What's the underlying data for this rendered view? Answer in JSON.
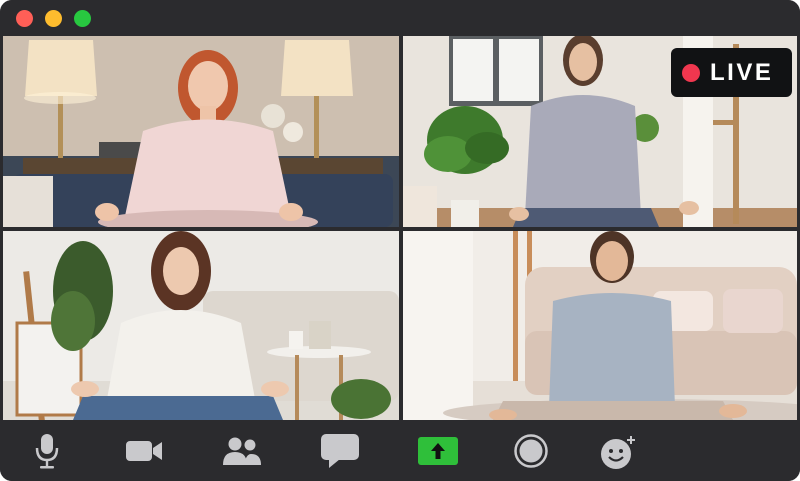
{
  "window": {
    "controls": [
      "close",
      "minimize",
      "maximize"
    ]
  },
  "live_badge": {
    "label": "LIVE",
    "dot_color": "#f0374f"
  },
  "participants": [
    {
      "tile": 1,
      "description_hidden": true
    },
    {
      "tile": 2,
      "description_hidden": true
    },
    {
      "tile": 3,
      "description_hidden": true
    },
    {
      "tile": 4,
      "description_hidden": true
    }
  ],
  "toolbar": {
    "buttons": [
      {
        "name": "microphone",
        "icon": "microphone-icon"
      },
      {
        "name": "camera",
        "icon": "video-camera-icon"
      },
      {
        "name": "participants",
        "icon": "people-icon"
      },
      {
        "name": "chat",
        "icon": "chat-bubble-icon"
      },
      {
        "name": "share-screen",
        "icon": "share-arrow-icon",
        "accent": "#2fbf3a"
      },
      {
        "name": "record",
        "icon": "record-icon"
      },
      {
        "name": "reactions",
        "icon": "emoji-add-icon"
      }
    ],
    "icon_color": "#c9c9cc"
  }
}
